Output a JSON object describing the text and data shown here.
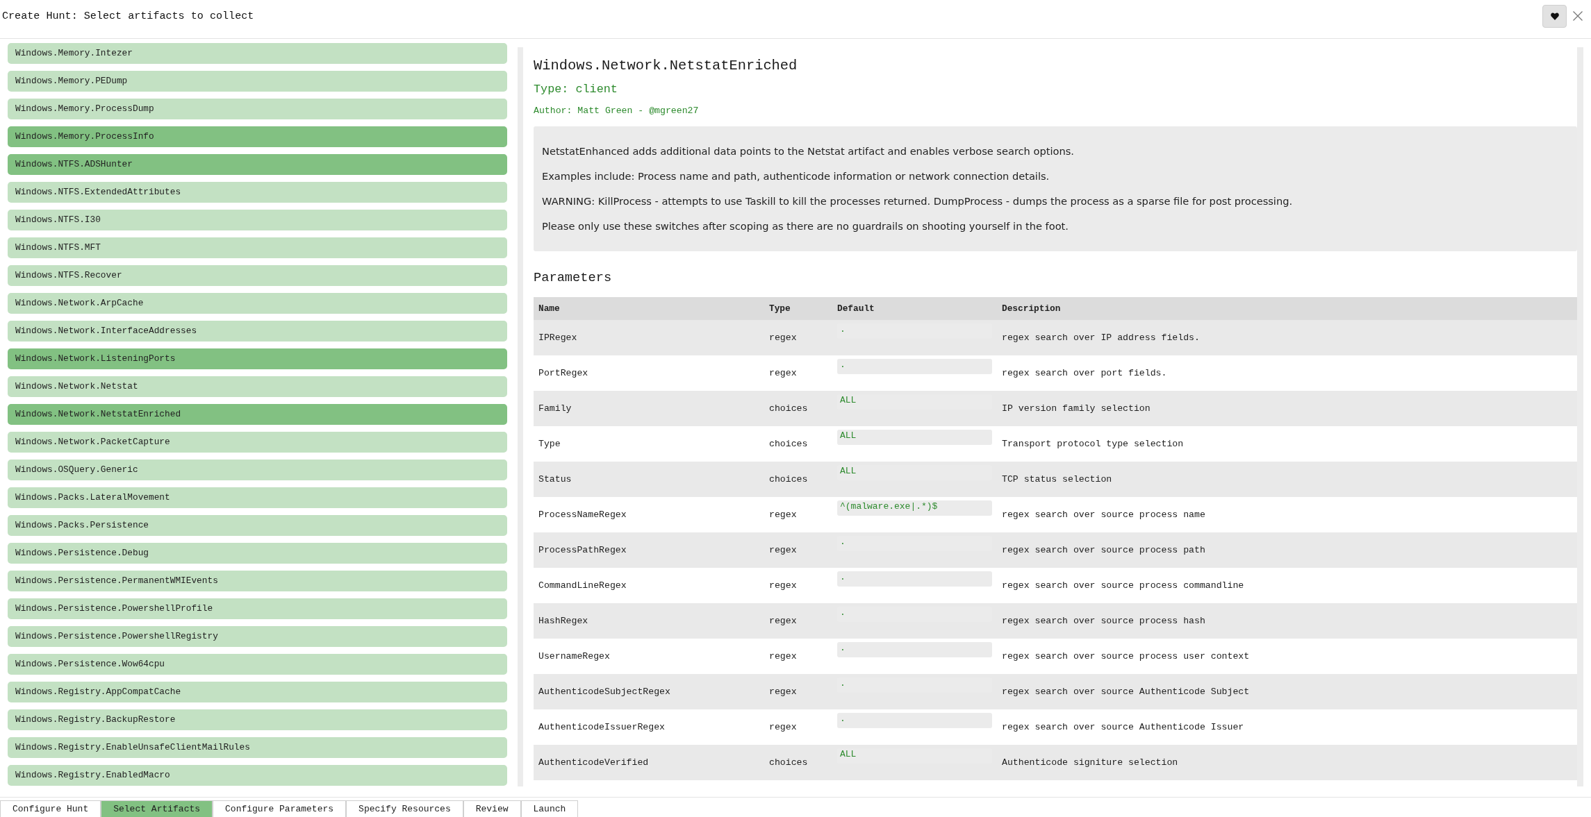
{
  "window": {
    "title": "Create Hunt: Select artifacts to collect"
  },
  "artifacts": [
    {
      "name": "Windows.Memory.Intezer",
      "selected": false
    },
    {
      "name": "Windows.Memory.PEDump",
      "selected": false
    },
    {
      "name": "Windows.Memory.ProcessDump",
      "selected": false
    },
    {
      "name": "Windows.Memory.ProcessInfo",
      "selected": true
    },
    {
      "name": "Windows.NTFS.ADSHunter",
      "selected": true
    },
    {
      "name": "Windows.NTFS.ExtendedAttributes",
      "selected": false
    },
    {
      "name": "Windows.NTFS.I30",
      "selected": false
    },
    {
      "name": "Windows.NTFS.MFT",
      "selected": false
    },
    {
      "name": "Windows.NTFS.Recover",
      "selected": false
    },
    {
      "name": "Windows.Network.ArpCache",
      "selected": false
    },
    {
      "name": "Windows.Network.InterfaceAddresses",
      "selected": false
    },
    {
      "name": "Windows.Network.ListeningPorts",
      "selected": true
    },
    {
      "name": "Windows.Network.Netstat",
      "selected": false
    },
    {
      "name": "Windows.Network.NetstatEnriched",
      "selected": true
    },
    {
      "name": "Windows.Network.PacketCapture",
      "selected": false
    },
    {
      "name": "Windows.OSQuery.Generic",
      "selected": false
    },
    {
      "name": "Windows.Packs.LateralMovement",
      "selected": false
    },
    {
      "name": "Windows.Packs.Persistence",
      "selected": false
    },
    {
      "name": "Windows.Persistence.Debug",
      "selected": false
    },
    {
      "name": "Windows.Persistence.PermanentWMIEvents",
      "selected": false
    },
    {
      "name": "Windows.Persistence.PowershellProfile",
      "selected": false
    },
    {
      "name": "Windows.Persistence.PowershellRegistry",
      "selected": false
    },
    {
      "name": "Windows.Persistence.Wow64cpu",
      "selected": false
    },
    {
      "name": "Windows.Registry.AppCompatCache",
      "selected": false
    },
    {
      "name": "Windows.Registry.BackupRestore",
      "selected": false
    },
    {
      "name": "Windows.Registry.EnableUnsafeClientMailRules",
      "selected": false
    },
    {
      "name": "Windows.Registry.EnabledMacro",
      "selected": false
    }
  ],
  "detail": {
    "title": "Windows.Network.NetstatEnriched",
    "type": "Type: client",
    "author": "Author: Matt Green - @mgreen27",
    "description": [
      "NetstatEnhanced adds additional data points to the Netstat artifact and enables verbose search options.",
      "Examples include: Process name and path, authenticode information or network connection details.",
      "WARNING: KillProcess - attempts to use Taskill to kill the processes returned. DumpProcess - dumps the process as a sparse file for post processing.",
      "Please only use these switches after scoping as there are no guardrails on shooting yourself in the foot."
    ],
    "parameters_heading": "Parameters",
    "table": {
      "columns": [
        "Name",
        "Type",
        "Default",
        "Description"
      ],
      "rows": [
        {
          "name": "IPRegex",
          "type": "regex",
          "default": ".",
          "description": "regex search over IP address fields."
        },
        {
          "name": "PortRegex",
          "type": "regex",
          "default": ".",
          "description": "regex search over port fields."
        },
        {
          "name": "Family",
          "type": "choices",
          "default": "ALL",
          "description": "IP version family selection"
        },
        {
          "name": "Type",
          "type": "choices",
          "default": "ALL",
          "description": "Transport protocol type selection"
        },
        {
          "name": "Status",
          "type": "choices",
          "default": "ALL",
          "description": "TCP status selection"
        },
        {
          "name": "ProcessNameRegex",
          "type": "regex",
          "default": "^(malware.exe|.*)$",
          "description": "regex search over source process name"
        },
        {
          "name": "ProcessPathRegex",
          "type": "regex",
          "default": ".",
          "description": "regex search over source process path"
        },
        {
          "name": "CommandLineRegex",
          "type": "regex",
          "default": ".",
          "description": "regex search over source process commandline"
        },
        {
          "name": "HashRegex",
          "type": "regex",
          "default": ".",
          "description": "regex search over source process hash"
        },
        {
          "name": "UsernameRegex",
          "type": "regex",
          "default": ".",
          "description": "regex search over source process user context"
        },
        {
          "name": "AuthenticodeSubjectRegex",
          "type": "regex",
          "default": ".",
          "description": "regex search over source Authenticode Subject"
        },
        {
          "name": "AuthenticodeIssuerRegex",
          "type": "regex",
          "default": ".",
          "description": "regex search over source Authenticode Issuer"
        },
        {
          "name": "AuthenticodeVerified",
          "type": "choices",
          "default": "ALL",
          "description": "Authenticode signiture selection"
        }
      ]
    }
  },
  "wizard_tabs": [
    {
      "label": "Configure Hunt",
      "selected": false
    },
    {
      "label": "Select Artifacts",
      "selected": true
    },
    {
      "label": "Configure Parameters",
      "selected": false
    },
    {
      "label": "Specify Resources",
      "selected": false
    },
    {
      "label": "Review",
      "selected": false
    },
    {
      "label": "Launch",
      "selected": false
    }
  ]
}
